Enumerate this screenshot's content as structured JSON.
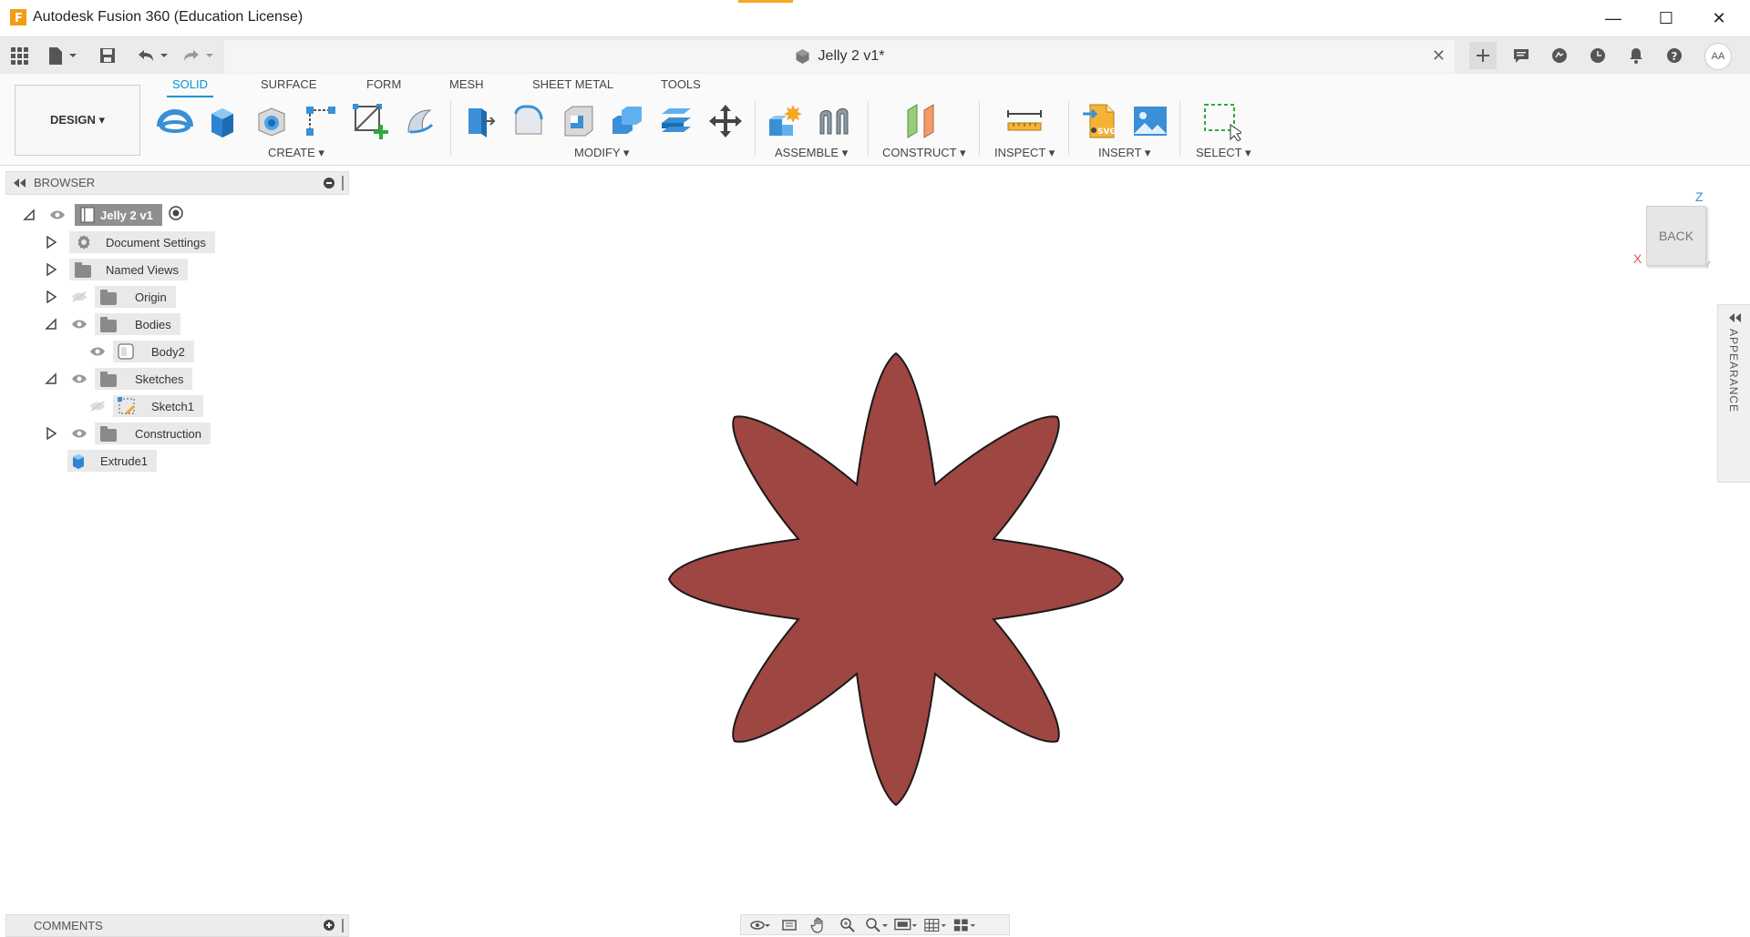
{
  "window": {
    "title": "Autodesk Fusion 360 (Education License)",
    "minimize": "—",
    "maximize": "☐",
    "close": "✕"
  },
  "document": {
    "tab_title": "Jelly 2 v1*",
    "close": "✕"
  },
  "quick_access": {
    "avatar": "AA"
  },
  "workspace": {
    "design_label": "DESIGN ▾"
  },
  "toolbar": {
    "tabs": [
      "SOLID",
      "SURFACE",
      "FORM",
      "MESH",
      "SHEET METAL",
      "TOOLS"
    ],
    "groups": {
      "create": "CREATE ▾",
      "modify": "MODIFY ▾",
      "assemble": "ASSEMBLE ▾",
      "construct": "CONSTRUCT ▾",
      "inspect": "INSPECT ▾",
      "insert": "INSERT ▾",
      "select": "SELECT ▾"
    }
  },
  "browser": {
    "title": "BROWSER",
    "root": "Jelly 2 v1",
    "items": [
      {
        "label": "Document Settings"
      },
      {
        "label": "Named Views"
      },
      {
        "label": "Origin"
      },
      {
        "label": "Bodies"
      },
      {
        "label": "Body2"
      },
      {
        "label": "Sketches"
      },
      {
        "label": "Sketch1"
      },
      {
        "label": "Construction"
      },
      {
        "label": "Extrude1"
      }
    ]
  },
  "viewcube": {
    "face": "BACK",
    "axis_z": "Z",
    "axis_x": "X",
    "axis_y": "Y"
  },
  "appearance_panel": {
    "label": "APPEARANCE"
  },
  "comments": {
    "title": "COMMENTS"
  },
  "colors": {
    "accent": "#0696d7",
    "shape_fill": "#9e4641",
    "shape_stroke": "#1a1a1a"
  }
}
